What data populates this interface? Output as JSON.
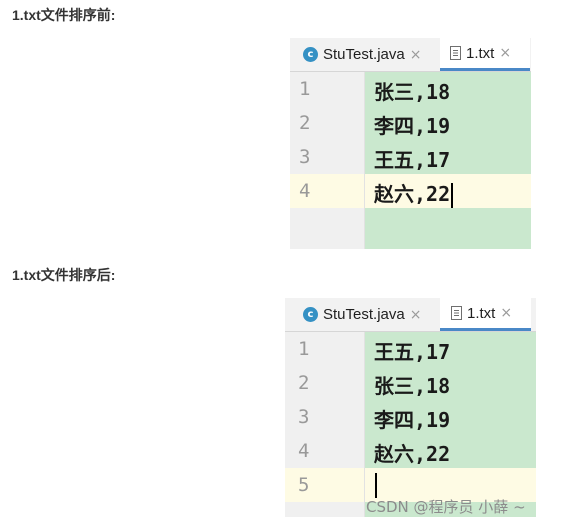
{
  "headings": {
    "before": "1.txt文件排序前:",
    "after": "1.txt文件排序后:"
  },
  "tabs": {
    "java_label": "StuTest.java",
    "txt_label": "1.txt",
    "java_icon_letter": "c",
    "close_glyph": "×"
  },
  "editor_before": {
    "line_numbers": [
      "1",
      "2",
      "3",
      "4"
    ],
    "lines": [
      "张三,18",
      "李四,19",
      "王五,17",
      "赵六,22"
    ],
    "current_line": 4
  },
  "editor_after": {
    "line_numbers": [
      "1",
      "2",
      "3",
      "4",
      "5"
    ],
    "lines": [
      "王五,17",
      "张三,18",
      "李四,19",
      "赵六,22",
      ""
    ],
    "current_line": 5
  },
  "watermark": "CSDN @程序员 小薛 ~",
  "colors": {
    "editor_bg": "#cae8ce",
    "current_line": "#fefbe4",
    "gutter": "#f0f0f0",
    "tab_accent": "#4a88c7",
    "java_icon": "#3591c4"
  }
}
